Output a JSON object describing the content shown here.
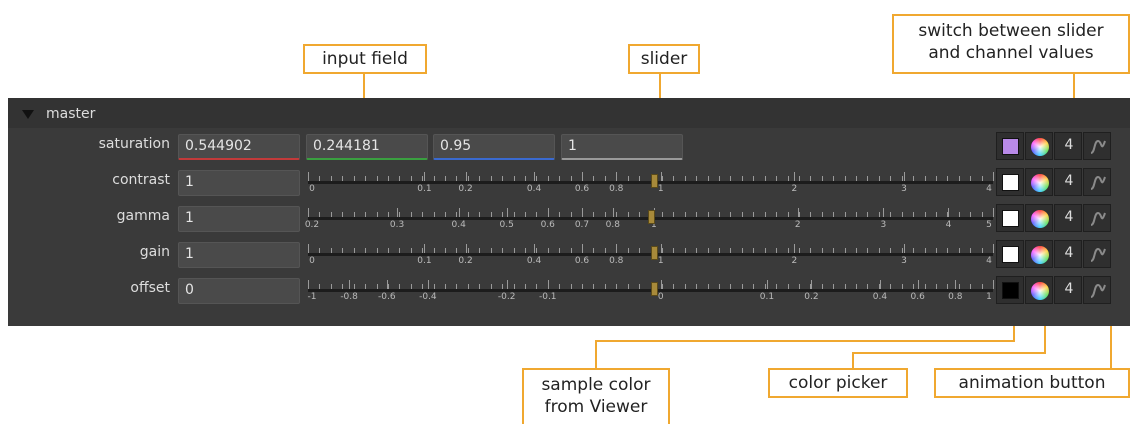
{
  "callouts": {
    "input_field": "input field",
    "slider": "slider",
    "switch_line1": "switch between slider",
    "switch_line2": "and channel values",
    "sample_line1": "sample color",
    "sample_line2": "from Viewer",
    "color_picker": "color picker",
    "animation_button": "animation button"
  },
  "panel": {
    "title": "master",
    "rows": [
      {
        "label": "saturation",
        "values": [
          "0.544902",
          "0.244181",
          "0.95",
          "1"
        ],
        "swatch": "#b98ae8",
        "channels": "4"
      },
      {
        "label": "contrast",
        "value": "1",
        "swatch": "#ffffff",
        "channels": "4",
        "ticks": [
          "0",
          "0.1",
          "0.2",
          "0.4",
          "0.6",
          "0.8",
          "1",
          "2",
          "3",
          "4"
        ]
      },
      {
        "label": "gamma",
        "value": "1",
        "swatch": "#ffffff",
        "channels": "4",
        "ticks": [
          "0.2",
          "0.3",
          "0.4",
          "0.5",
          "0.6",
          "0.7",
          "0.8",
          "1",
          "2",
          "3",
          "4",
          "5"
        ]
      },
      {
        "label": "gain",
        "value": "1",
        "swatch": "#ffffff",
        "channels": "4",
        "ticks": [
          "0",
          "0.1",
          "0.2",
          "0.4",
          "0.6",
          "0.8",
          "1",
          "2",
          "3",
          "4"
        ]
      },
      {
        "label": "offset",
        "value": "0",
        "swatch": "#000000",
        "channels": "4",
        "ticks": [
          "-1",
          "-0.8",
          "-0.6",
          "-0.4",
          "-0.2",
          "-0.1",
          "0",
          "0.1",
          "0.2",
          "0.4",
          "0.6",
          "0.8",
          "1"
        ]
      }
    ]
  }
}
